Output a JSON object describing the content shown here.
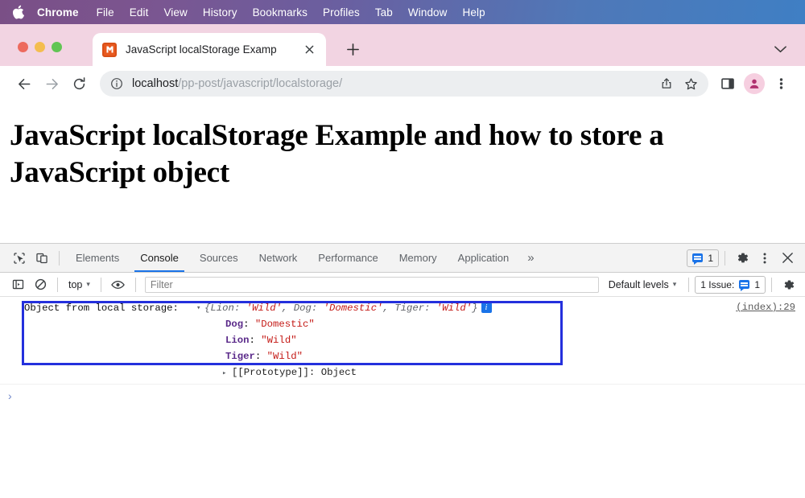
{
  "menubar": {
    "apple_icon": "apple-logo",
    "items": [
      {
        "label": "Chrome",
        "bold": true
      },
      {
        "label": "File",
        "bold": false
      },
      {
        "label": "Edit",
        "bold": false
      },
      {
        "label": "View",
        "bold": false
      },
      {
        "label": "History",
        "bold": false
      },
      {
        "label": "Bookmarks",
        "bold": false
      },
      {
        "label": "Profiles",
        "bold": false
      },
      {
        "label": "Tab",
        "bold": false
      },
      {
        "label": "Window",
        "bold": false
      },
      {
        "label": "Help",
        "bold": false
      }
    ]
  },
  "browser": {
    "tab": {
      "title": "JavaScript localStorage Examp",
      "favicon": "site-favicon",
      "close_icon": "close-icon"
    },
    "new_tab_icon": "plus-icon",
    "tab_list_chevron_icon": "chevron-down-icon",
    "nav": {
      "back_icon": "back-arrow-icon",
      "forward_icon": "forward-arrow-icon",
      "reload_icon": "reload-icon"
    },
    "omnibox": {
      "info_icon": "info-circle-icon",
      "host": "localhost",
      "path": "/pp-post/javascript/localstorage/",
      "share_icon": "share-icon",
      "bookmark_icon": "star-icon"
    },
    "side_panel_icon": "side-panel-icon",
    "avatar_icon": "profile-avatar-icon",
    "menu_icon": "three-dot-menu-icon"
  },
  "page": {
    "heading": "JavaScript localStorage Example and how to store a JavaScript object"
  },
  "devtools": {
    "inspect_icon": "inspect-element-icon",
    "device_toolbar_icon": "device-toolbar-icon",
    "tabs": [
      {
        "label": "Elements",
        "active": false
      },
      {
        "label": "Console",
        "active": true
      },
      {
        "label": "Sources",
        "active": false
      },
      {
        "label": "Network",
        "active": false
      },
      {
        "label": "Performance",
        "active": false
      },
      {
        "label": "Memory",
        "active": false
      },
      {
        "label": "Application",
        "active": false
      }
    ],
    "more_tabs_label": "»",
    "message_count": "1",
    "message_icon": "message-badge-icon",
    "settings_icon": "gear-icon",
    "menu_icon": "three-dot-menu-icon",
    "close_icon": "close-icon",
    "filterbar": {
      "sidebar_icon": "console-sidebar-icon",
      "clear_icon": "clear-console-icon",
      "context": "top",
      "eye_icon": "live-expression-icon",
      "filter_placeholder": "Filter",
      "levels": "Default levels",
      "issues_label": "1 Issue:",
      "issues_count": "1",
      "issues_icon": "message-badge-icon",
      "settings_icon": "gear-icon",
      "caret": "▾"
    },
    "console": {
      "message_label": "Object from local storage:",
      "expand_triangle": "▾",
      "object_preview": {
        "open_brace": "{",
        "close_brace": "}",
        "entries": [
          {
            "key": "Lion",
            "value": "'Wild'"
          },
          {
            "key": "Dog",
            "value": "'Domestic'"
          },
          {
            "key": "Tiger",
            "value": "'Wild'"
          }
        ],
        "separator": ", ",
        "info_badge": "i"
      },
      "properties": [
        {
          "key": "Dog",
          "value": "\"Domestic\""
        },
        {
          "key": "Lion",
          "value": "\"Wild\""
        },
        {
          "key": "Tiger",
          "value": "\"Wild\""
        }
      ],
      "prototype_triangle": "▸",
      "prototype_label": "[[Prototype]]: Object",
      "source_link": "(index):29",
      "prompt_symbol": "›",
      "annotation_color": "#2430dd"
    }
  }
}
